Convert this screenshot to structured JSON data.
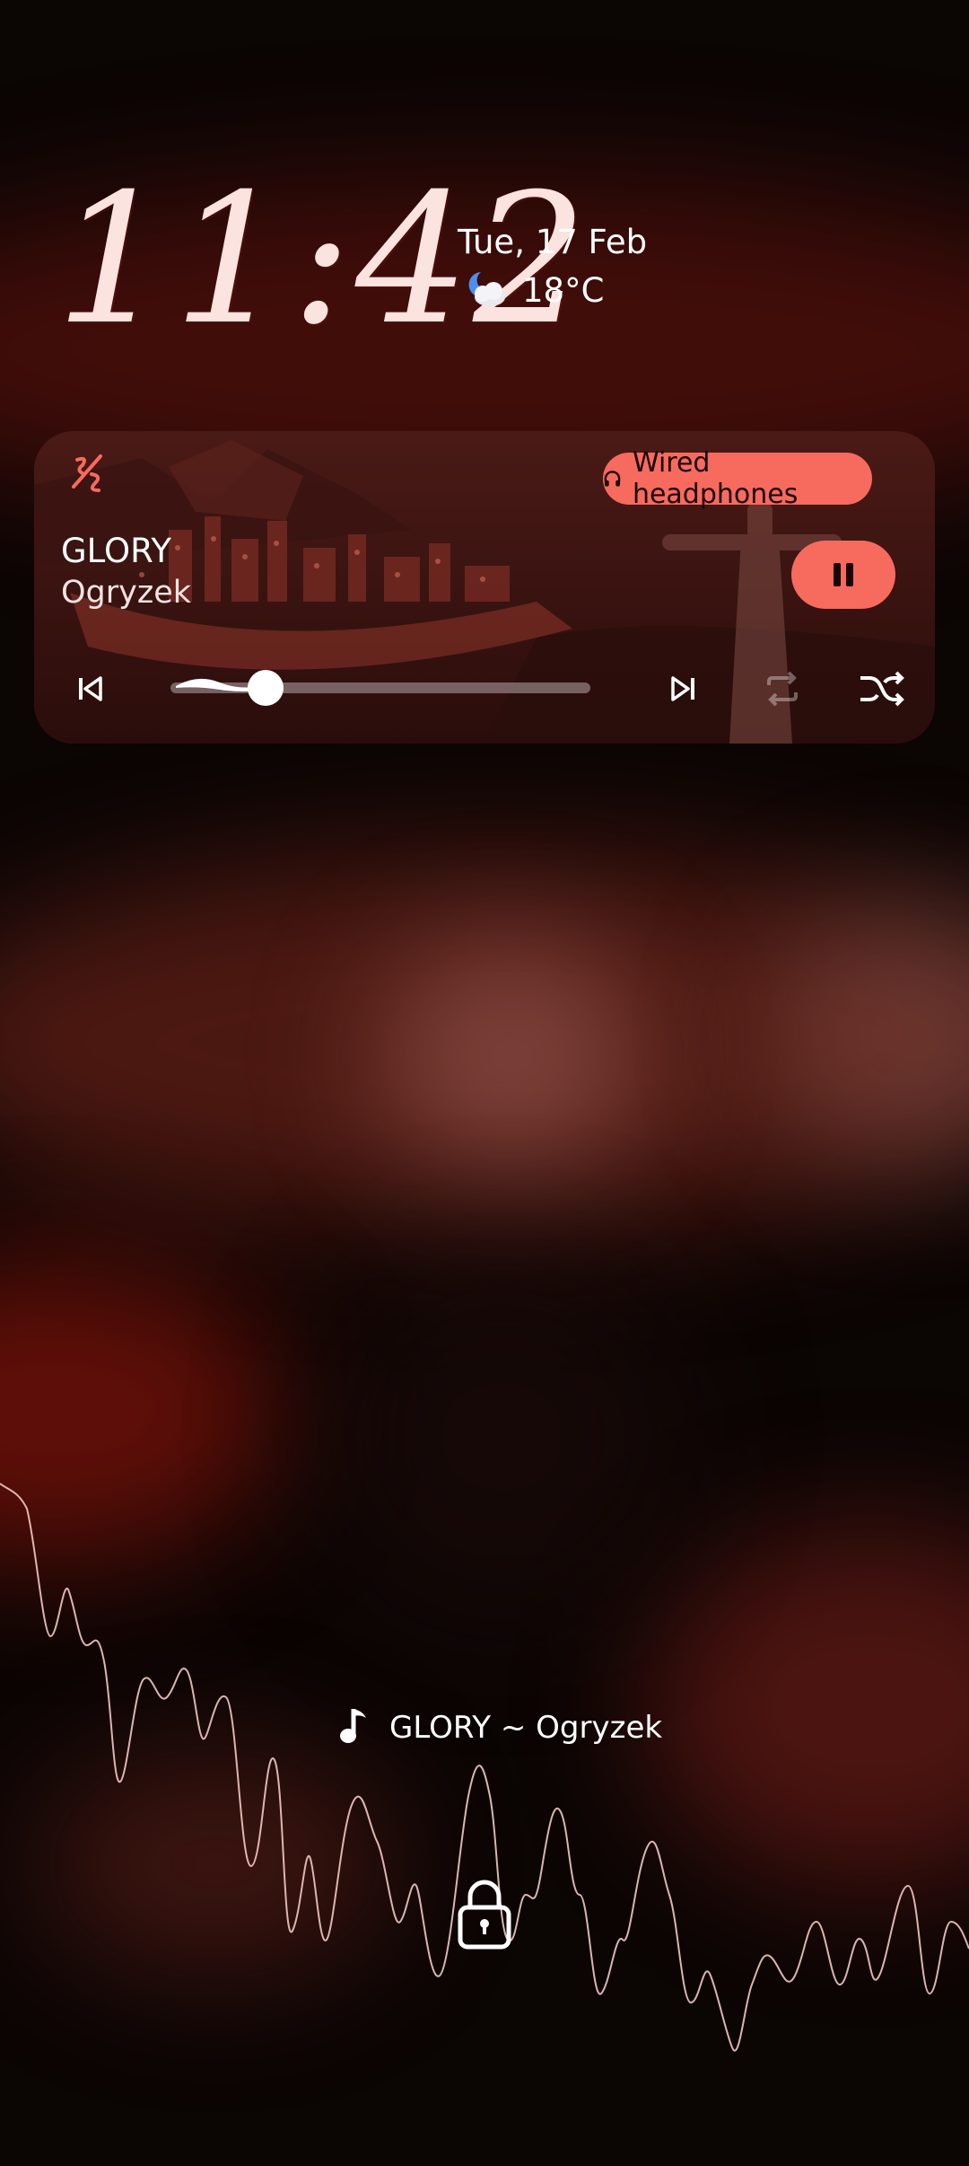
{
  "clock": {
    "time": "11:42"
  },
  "date": {
    "text": "Tue, 17 Feb"
  },
  "weather": {
    "temperature": "18°C",
    "icon": "night-cloudy-icon"
  },
  "media": {
    "app_icon": "music-app-icon",
    "output_device": "Wired headphones",
    "track_title": "GLORY",
    "artist": "Ogryzek",
    "progress": 0.22,
    "controls": {
      "previous": "skip-previous-icon",
      "play_pause": "pause-icon",
      "next": "skip-next-icon",
      "repeat": "repeat-icon",
      "shuffle": "shuffle-icon"
    },
    "accent_color": "#f76a5e"
  },
  "now_playing": {
    "text": "GLORY ~ Ogryzek",
    "icon": "music-note-icon"
  },
  "lock": {
    "icon": "lock-icon"
  }
}
